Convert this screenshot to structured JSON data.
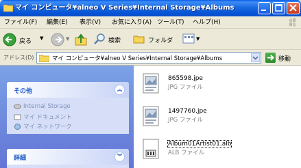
{
  "window": {
    "title": "マイ コンピュータ¥alneo V Series¥Internal Storage¥Albums"
  },
  "menu": {
    "file": "ファイル(F)",
    "edit": "編集(E)",
    "view": "表示(V)",
    "favorites": "お気に入り(A)",
    "tools": "ツール(T)",
    "help": "ヘルプ(H)"
  },
  "toolbar": {
    "back": "戻る",
    "search": "検索",
    "folders": "フォルダ"
  },
  "address": {
    "label": "アドレス(D)",
    "path": "マイ コンピュータ¥alneo V Series¥Internal Storage¥Albums",
    "go": "移動"
  },
  "taskpane": {
    "other": {
      "title": "その他",
      "links": [
        {
          "label": "Internal Storage",
          "icon": "drive-icon"
        },
        {
          "label": "マイ ドキュメント",
          "icon": "documents-icon"
        },
        {
          "label": "マイ ネットワーク",
          "icon": "network-icon"
        }
      ]
    },
    "details": {
      "title": "詳細"
    }
  },
  "files": [
    {
      "name": "865598.jpe",
      "type": "JPG ファイル",
      "icon": "image-file-icon"
    },
    {
      "name": "1497760.jpe",
      "type": "JPG ファイル",
      "icon": "image-file-icon"
    },
    {
      "name": "Album01Artist01.alb",
      "type": "ALB ファイル",
      "icon": "album-file-icon",
      "selected": true
    }
  ],
  "colors": {
    "titlebar": "#0a5ee8",
    "taskpane_bg": "#7ba2e7",
    "panel_title": "#215dc6"
  }
}
